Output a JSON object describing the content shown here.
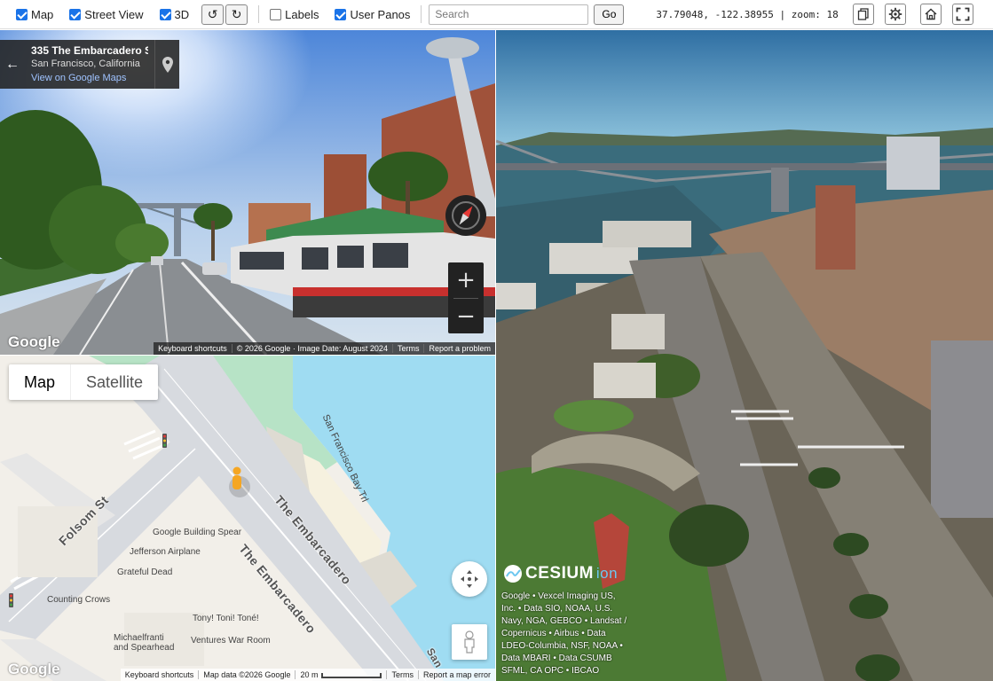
{
  "toolbar": {
    "map_label": "Map",
    "street_view_label": "Street View",
    "three_d_label": "3D",
    "rotate_ccw_label": "↺",
    "rotate_cw_label": "↻",
    "labels_label": "Labels",
    "user_panos_label": "User Panos",
    "search_placeholder": "Search",
    "go_label": "Go",
    "coords": "37.79048, -122.38955 | zoom: 18"
  },
  "street_view": {
    "address_title": "335 The Embarcadero S",
    "address_city": "San Francisco, California",
    "view_link": "View on Google Maps",
    "google_logo": "Google",
    "zoom_in": "+",
    "zoom_out": "−",
    "attribution": [
      "Keyboard shortcuts",
      "© 2026 Google · Image Date: August 2024",
      "Terms",
      "Report a problem"
    ]
  },
  "map": {
    "type_map": "Map",
    "type_satellite": "Satellite",
    "labels": {
      "folsom": "Folsom St",
      "embarcadero_1": "The Embarcadero",
      "embarcadero_2": "The Embarcadero",
      "bay_trail": "San Francisco Bay Trl",
      "google_spear": "Google Building Spear",
      "jefferson": "Jefferson Airplane",
      "grateful": "Grateful Dead",
      "counting": "Counting Crows",
      "tony": "Tony! Toni! Toné!",
      "michael": "Michaelfranti\nand Spearhead",
      "ventures": "Ventures War Room",
      "san_cut": "San"
    },
    "google_logo": "Google",
    "attribution": {
      "shortcuts": "Keyboard shortcuts",
      "data": "Map data ©2026 Google",
      "scale": "20 m",
      "terms": "Terms",
      "report": "Report a map error"
    }
  },
  "cesium": {
    "logo_text": "CESIUM",
    "logo_ion": "ion",
    "credits": "Google • Vexcel Imaging US, Inc. • Data SIO, NOAA, U.S. Navy, NGA, GEBCO • Landsat / Copernicus • Airbus • Data LDEO-Columbia, NSF, NOAA • Data MBARI • Data CSUMB SFML, CA OPC • IBCAO"
  }
}
